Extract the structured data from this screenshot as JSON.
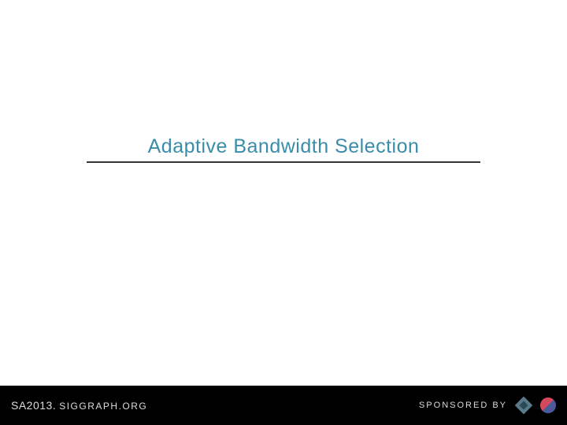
{
  "slide": {
    "title": "Adaptive Bandwidth Selection"
  },
  "footer": {
    "conference_short": "SA2013.",
    "conference_org": "SIGGRAPH.ORG",
    "sponsored_label": "SPONSORED BY"
  }
}
